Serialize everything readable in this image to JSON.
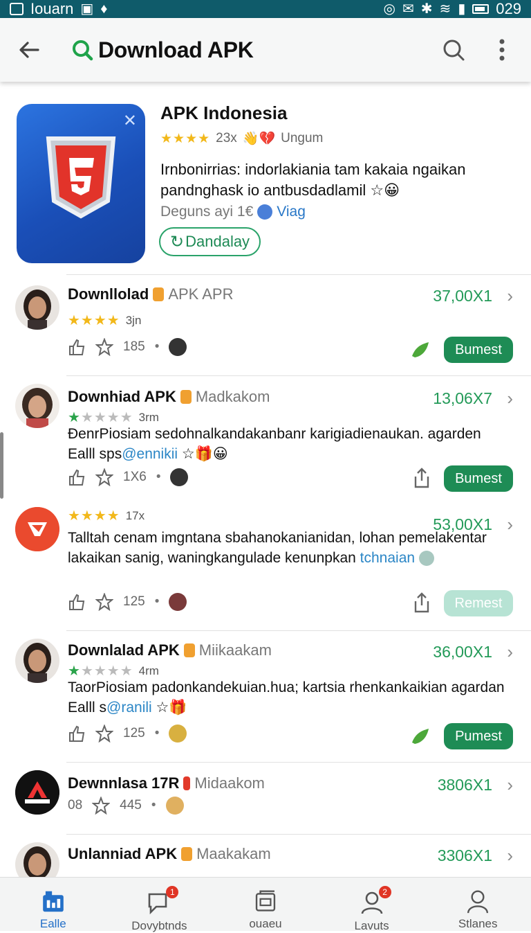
{
  "status_bar": {
    "carrier": "Iouarn",
    "time": "029"
  },
  "app_bar": {
    "title": "Download APK"
  },
  "featured": {
    "title": "APK Indonesia",
    "stars": "★★★★",
    "count": "23x",
    "emoji": "👋💔",
    "category": "Ungum",
    "description_bold": "Irnbonirrias: indorlakiania",
    "description": " tam kakaia ngaikan pandnghask io antbusdadlamil",
    "desc_emoji": "☆😀",
    "sub_text": "Deguns ayi 1€",
    "sub_tag": "Viag",
    "button_label": "Dandalay"
  },
  "rows": [
    {
      "name": "Downllolad",
      "sub": "APK APR",
      "price": "37,00X1",
      "stars": "★★★★",
      "rating_text": "3jn",
      "count": "185",
      "cta": "Bumest"
    },
    {
      "name": "Downhiad APK",
      "sub": "Madkakom",
      "price": "13,06X7",
      "stars_green": "★",
      "stars_grey": "★★★★",
      "rating_text": "3rm",
      "desc": "ĐenrPiosiam sedohnalkandakanbanr karigiadienaukan. agarden Ealll sps",
      "desc_link": "@ennikii",
      "desc_emoji": "☆🎁😀",
      "count": "1X6",
      "cta": "Bumest"
    },
    {
      "name": "",
      "price": "53,00X1",
      "stars": "★★★★",
      "rating_text": "17x",
      "desc": "Talltah cenam imgntana sbahanokanianidan, lohan pemelakentar lakaikan sanig, waningkangulade kenunpkan",
      "desc_link": "tchnaian",
      "count": "125",
      "cta": "Remest"
    },
    {
      "name": "Downlalad APK",
      "sub": "Miikaakam",
      "price": "36,00X1",
      "stars_green": "★",
      "stars_grey": "★★★★",
      "rating_text": "4rm",
      "desc": "TaorPiosiam padonkandekuian.hua; kartsia rhenkankaikian agardan Ealll s",
      "desc_link": "@ranili",
      "desc_emoji": "☆🎁",
      "count": "125",
      "cta": "Pumest"
    },
    {
      "name": "Dewnnlasa 17R",
      "sub": "Midaakom",
      "price": "3806X1",
      "prefix": "08",
      "count": "445"
    },
    {
      "name": "Unlanniad APK",
      "sub": "Maakakam",
      "price": "3306X1"
    }
  ],
  "bottom_nav": [
    {
      "label": "Ealle",
      "badge": ""
    },
    {
      "label": "Dovybtnds",
      "badge": "1"
    },
    {
      "label": "ouaeu",
      "badge": ""
    },
    {
      "label": "Lavuts",
      "badge": "2"
    },
    {
      "label": "Stlanes",
      "badge": ""
    }
  ],
  "colors": {
    "accent_green": "#1e8c55",
    "status_bar": "#0f5b6a",
    "link_blue": "#2b86c6",
    "star_gold": "#f2b81a"
  }
}
